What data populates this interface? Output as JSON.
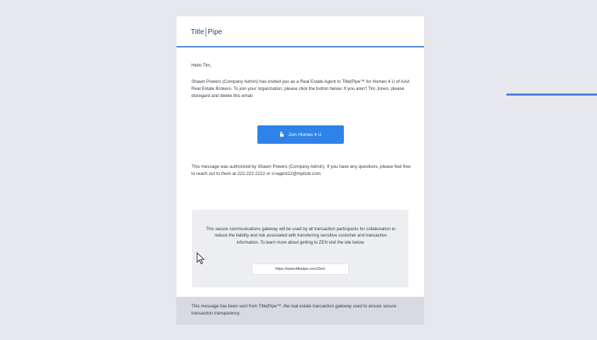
{
  "email": {
    "logo": {
      "left": "Title",
      "right": "Pipe"
    },
    "greeting": "Hello Tim,",
    "intro": "Shawn Powers (Company Admin) has invited you as a Real Estate Agent to Title|Pipe™ for Homes 4 U of AAA Real Estate Brokers. To join your organization, please click the button below. If you aren't Tim Jones, please disregard and delete this email.",
    "join_button_label": "Join Homes 4 U",
    "authorized": "This message was authorized by Shawn Powers (Company Admin). If you have any questions, please feel free to reach out to them at 222-222-2222 or s+agent22@mphub.com",
    "gateway": {
      "text": "This secure communications gateway will be used by all transaction participants for collaboration to reduce the liability and risk associated with transferring sensitive customer and transaction information. To learn more about getting to ZEN visit the site below.",
      "link": "https://www.titlepipe.com/Zen/"
    },
    "footer": "This message has been sent from Title|Pipe™, the real estate transaction gateway used to ensure secure transaction transparency."
  },
  "icons": {
    "button_icon": "lock-icon",
    "pointer": "cursor-arrow-icon"
  },
  "colors": {
    "accent": "#2f83e8",
    "header_rule": "#4a86d6",
    "background": "#e7e8ed"
  }
}
